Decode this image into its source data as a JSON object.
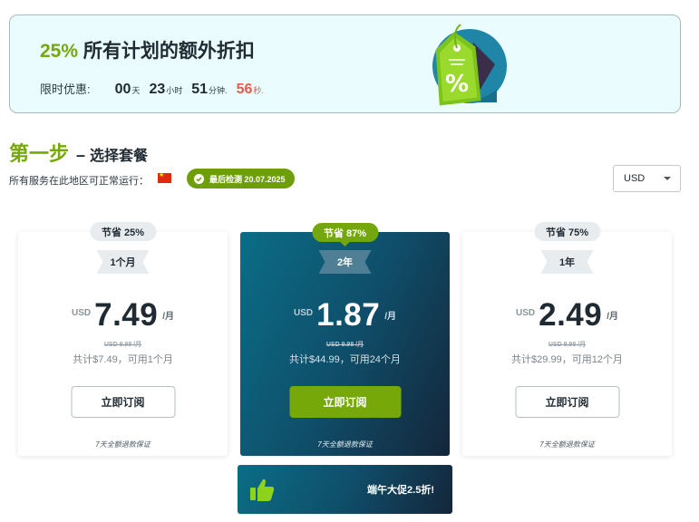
{
  "banner": {
    "percent": "25%",
    "title": "所有计划的额外折扣",
    "countdown_label": "限时优惠:",
    "countdown": [
      {
        "value": "00",
        "unit": "天"
      },
      {
        "value": "23",
        "unit": "小时"
      },
      {
        "value": "51",
        "unit": "分钟."
      },
      {
        "value": "56",
        "unit": "秒."
      }
    ],
    "tag_symbol": "%"
  },
  "step": {
    "number": "第一步",
    "dash": "–",
    "title": "选择套餐"
  },
  "region": {
    "text": "所有服务在此地区可正常运行：",
    "badge": "最后检测 20.07.2025"
  },
  "currency": {
    "selected": "USD"
  },
  "plans": [
    {
      "save": "节省 25%",
      "term": "1个月",
      "currency": "USD",
      "price": "7.49",
      "per": "/月",
      "old_price": "USD 9.98 /月",
      "total": "共计$7.49，可用1个月",
      "button": "立即订阅",
      "guarantee": "7天全额退款保证"
    },
    {
      "save": "节省 87%",
      "term": "2年",
      "currency": "USD",
      "price": "1.87",
      "per": "/月",
      "old_price": "USD 9.98 /月",
      "total": "共计$44.99，可用24个月",
      "button": "立即订阅",
      "guarantee": "7天全额退款保证"
    },
    {
      "save": "节省 75%",
      "term": "1年",
      "currency": "USD",
      "price": "2.49",
      "per": "/月",
      "old_price": "USD 9.98 /月",
      "total": "共计$29.99，可用12个月",
      "button": "立即订阅",
      "guarantee": "7天全额退款保证"
    }
  ],
  "deal": {
    "text": "端午大促2.5折!"
  },
  "colors": {
    "accent_green": "#76a80a",
    "countdown_seconds": "#e35d4b",
    "featured_start": "#0b6d86",
    "featured_end": "#14263a"
  },
  "icons": {
    "tag": "discount-tag-icon",
    "check": "check-circle-icon",
    "thumb": "thumbs-up-icon",
    "flag": "china-flag-icon"
  }
}
